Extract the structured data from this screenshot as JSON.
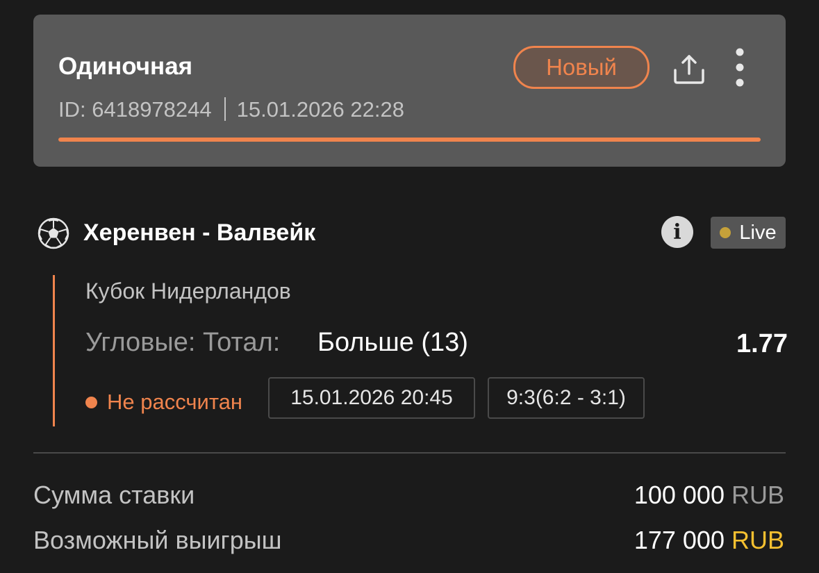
{
  "header": {
    "bet_type": "Одиночная",
    "status": "Новый",
    "id_label": "ID: 6418978244",
    "datetime": "15.01.2026 22:28",
    "progress_fraction": 1.0,
    "icons": {
      "share": "share-icon",
      "more": "more-vertical-icon"
    }
  },
  "event": {
    "sport_icon": "soccer-ball-icon",
    "name": "Херенвен - Валвейк",
    "info_icon_text": "i",
    "live_label": "Live",
    "league": "Кубок Нидерландов",
    "market": "Угловые: Тотал:",
    "outcome": "Больше (13)",
    "odds": "1.77",
    "settle_status": "Не рассчитан",
    "start_datetime": "15.01.2026 20:45",
    "score": "9:3(6:2 - 3:1)"
  },
  "summary": {
    "stake_label": "Сумма ставки",
    "stake_amount": "100 000",
    "stake_currency": "RUB",
    "payout_label": "Возможный выигрыш",
    "payout_amount": "177 000",
    "payout_currency": "RUB"
  },
  "colors": {
    "accent": "#f0844d",
    "live_dot": "#c5a13a",
    "gold": "#f5c030",
    "background": "#1b1b1b",
    "card": "#595959"
  }
}
